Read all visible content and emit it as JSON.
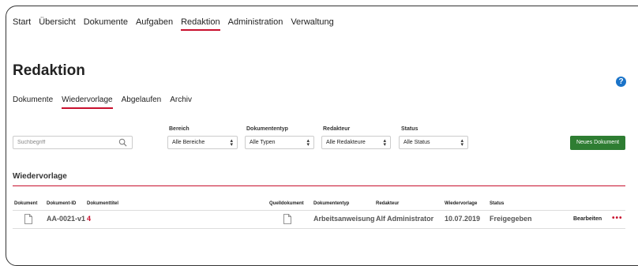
{
  "topnav": {
    "items": [
      {
        "label": "Start"
      },
      {
        "label": "Übersicht"
      },
      {
        "label": "Dokumente"
      },
      {
        "label": "Aufgaben"
      },
      {
        "label": "Redaktion"
      },
      {
        "label": "Administration"
      },
      {
        "label": "Verwaltung"
      }
    ],
    "active": "Redaktion"
  },
  "page": {
    "title": "Redaktion",
    "help_icon": "?"
  },
  "subtabs": {
    "items": [
      {
        "label": "Dokumente"
      },
      {
        "label": "Wiedervorlage"
      },
      {
        "label": "Abgelaufen"
      },
      {
        "label": "Archiv"
      }
    ],
    "active": "Wiedervorlage"
  },
  "filters": {
    "search_placeholder": "Suchbegriff",
    "bereich": {
      "label": "Bereich",
      "value": "Alle Bereiche"
    },
    "dokumententyp": {
      "label": "Dokumententyp",
      "value": "Alle Typen"
    },
    "redakteur": {
      "label": "Redakteur",
      "value": "Alle Redakteure"
    },
    "status": {
      "label": "Status",
      "value": "Alle Status"
    }
  },
  "new_document_button": "Neues Dokument",
  "section": {
    "title": "Wiedervorlage"
  },
  "table": {
    "headers": {
      "dokument": "Dokument",
      "dokument_id": "Dokument-ID",
      "dokumenttitel": "Dokumenttitel",
      "quelldokument": "Quelldokument",
      "dokumententyp": "Dokumententyp",
      "redakteur": "Redakteur",
      "wiedervorlage": "Wiedervorlage",
      "status": "Status"
    },
    "rows": [
      {
        "dokument_id": "AA-0021-v1",
        "dokumenttitel": "4",
        "dokumententyp": "Arbeitsanweisung",
        "redakteur": "Alf Administrator",
        "wiedervorlage": "10.07.2019",
        "status": "Freigegeben",
        "action": "Bearbeiten",
        "more": "•••"
      }
    ]
  },
  "colors": {
    "accent": "#c8102e",
    "primary_button": "#2e7d32",
    "help": "#1a73c8"
  },
  "icons": {
    "search": "search-icon",
    "document": "document-icon",
    "more": "more-icon",
    "help": "help-icon"
  }
}
